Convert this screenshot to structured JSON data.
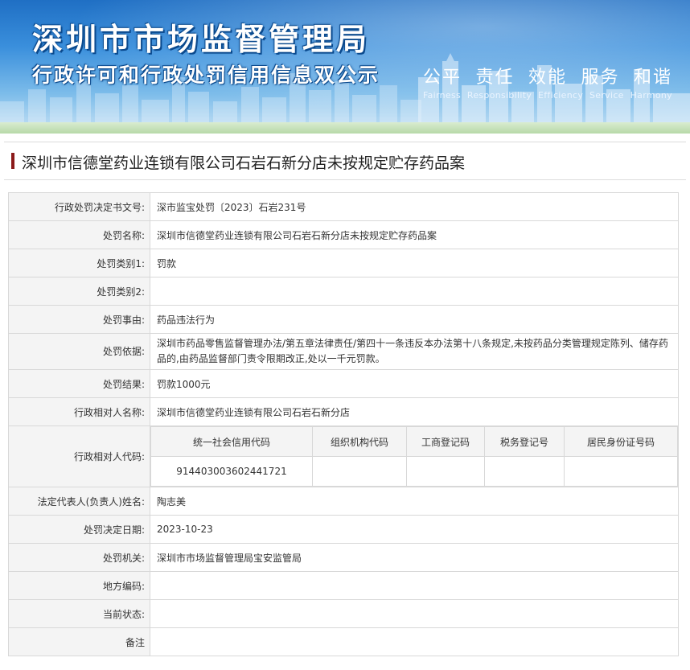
{
  "banner": {
    "title": "深圳市市场监督管理局",
    "subtitle": "行政许可和行政处罚信用信息双公示",
    "slogans_cn": [
      "公平",
      "责任",
      "效能",
      "服务",
      "和谐"
    ],
    "slogans_en": [
      "Fairness",
      "Responsibility",
      "Efficiency",
      "Service",
      "Harmony"
    ]
  },
  "case_title": "深圳市信德堂药业连锁有限公司石岩石新分店未按规定贮存药品案",
  "fields": {
    "doc_no_label": "行政处罚决定书文号:",
    "doc_no": "深市监宝处罚〔2023〕石岩231号",
    "name_label": "处罚名称:",
    "name": "深圳市信德堂药业连锁有限公司石岩石新分店未按规定贮存药品案",
    "cat1_label": "处罚类别1:",
    "cat1": "罚款",
    "cat2_label": "处罚类别2:",
    "cat2": "",
    "reason_label": "处罚事由:",
    "reason": "药品违法行为",
    "basis_label": "处罚依据:",
    "basis": "深圳市药品零售监督管理办法/第五章法律责任/第四十一条违反本办法第十八条规定,未按药品分类管理规定陈列、储存药品的,由药品监督部门责令限期改正,处以一千元罚款。",
    "result_label": "处罚结果:",
    "result": "罚款1000元",
    "party_name_label": "行政相对人名称:",
    "party_name": "深圳市信德堂药业连锁有限公司石岩石新分店",
    "party_code_label": "行政相对人代码:",
    "code_headers": [
      "统一社会信用代码",
      "组织机构代码",
      "工商登记码",
      "税务登记号",
      "居民身份证号码"
    ],
    "code_values": [
      "914403003602441721",
      "",
      "",
      "",
      ""
    ],
    "legal_rep_label": "法定代表人(负责人)姓名:",
    "legal_rep": "陶志美",
    "date_label": "处罚决定日期:",
    "date": "2023-10-23",
    "authority_label": "处罚机关:",
    "authority": "深圳市市场监督管理局宝安监管局",
    "area_code_label": "地方编码:",
    "area_code": "",
    "status_label": "当前状态:",
    "status": "",
    "remark_label": "备注",
    "remark": ""
  }
}
